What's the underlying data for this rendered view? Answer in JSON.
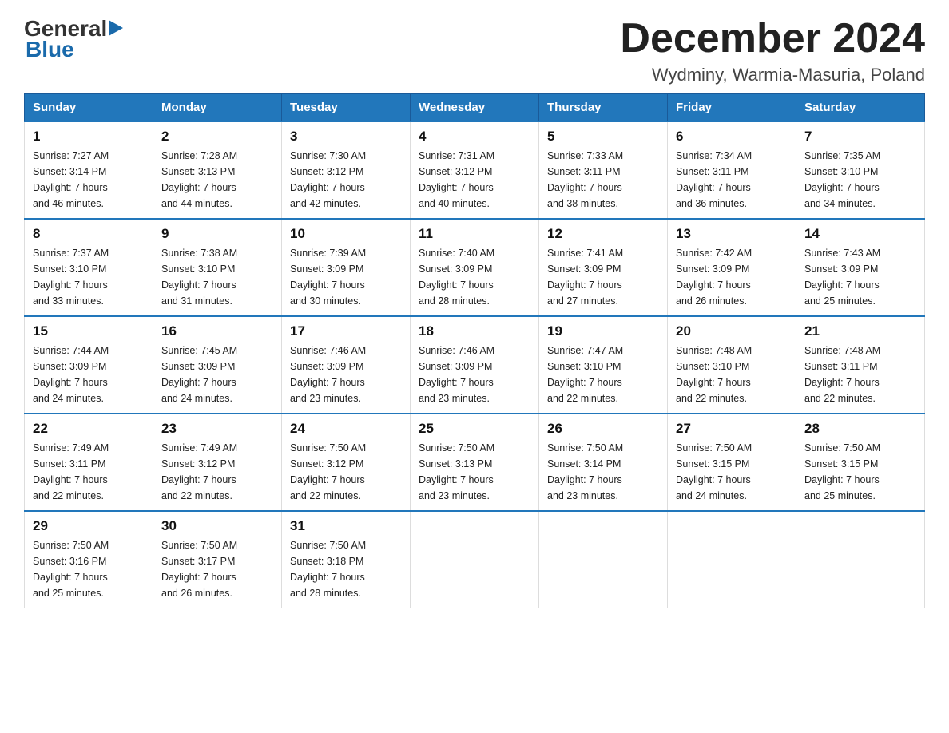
{
  "header": {
    "logo_general": "General",
    "logo_blue": "Blue",
    "title": "December 2024",
    "subtitle": "Wydminy, Warmia-Masuria, Poland"
  },
  "days_of_week": [
    "Sunday",
    "Monday",
    "Tuesday",
    "Wednesday",
    "Thursday",
    "Friday",
    "Saturday"
  ],
  "weeks": [
    [
      {
        "day": "1",
        "sunrise": "7:27 AM",
        "sunset": "3:14 PM",
        "daylight": "7 hours and 46 minutes."
      },
      {
        "day": "2",
        "sunrise": "7:28 AM",
        "sunset": "3:13 PM",
        "daylight": "7 hours and 44 minutes."
      },
      {
        "day": "3",
        "sunrise": "7:30 AM",
        "sunset": "3:12 PM",
        "daylight": "7 hours and 42 minutes."
      },
      {
        "day": "4",
        "sunrise": "7:31 AM",
        "sunset": "3:12 PM",
        "daylight": "7 hours and 40 minutes."
      },
      {
        "day": "5",
        "sunrise": "7:33 AM",
        "sunset": "3:11 PM",
        "daylight": "7 hours and 38 minutes."
      },
      {
        "day": "6",
        "sunrise": "7:34 AM",
        "sunset": "3:11 PM",
        "daylight": "7 hours and 36 minutes."
      },
      {
        "day": "7",
        "sunrise": "7:35 AM",
        "sunset": "3:10 PM",
        "daylight": "7 hours and 34 minutes."
      }
    ],
    [
      {
        "day": "8",
        "sunrise": "7:37 AM",
        "sunset": "3:10 PM",
        "daylight": "7 hours and 33 minutes."
      },
      {
        "day": "9",
        "sunrise": "7:38 AM",
        "sunset": "3:10 PM",
        "daylight": "7 hours and 31 minutes."
      },
      {
        "day": "10",
        "sunrise": "7:39 AM",
        "sunset": "3:09 PM",
        "daylight": "7 hours and 30 minutes."
      },
      {
        "day": "11",
        "sunrise": "7:40 AM",
        "sunset": "3:09 PM",
        "daylight": "7 hours and 28 minutes."
      },
      {
        "day": "12",
        "sunrise": "7:41 AM",
        "sunset": "3:09 PM",
        "daylight": "7 hours and 27 minutes."
      },
      {
        "day": "13",
        "sunrise": "7:42 AM",
        "sunset": "3:09 PM",
        "daylight": "7 hours and 26 minutes."
      },
      {
        "day": "14",
        "sunrise": "7:43 AM",
        "sunset": "3:09 PM",
        "daylight": "7 hours and 25 minutes."
      }
    ],
    [
      {
        "day": "15",
        "sunrise": "7:44 AM",
        "sunset": "3:09 PM",
        "daylight": "7 hours and 24 minutes."
      },
      {
        "day": "16",
        "sunrise": "7:45 AM",
        "sunset": "3:09 PM",
        "daylight": "7 hours and 24 minutes."
      },
      {
        "day": "17",
        "sunrise": "7:46 AM",
        "sunset": "3:09 PM",
        "daylight": "7 hours and 23 minutes."
      },
      {
        "day": "18",
        "sunrise": "7:46 AM",
        "sunset": "3:09 PM",
        "daylight": "7 hours and 23 minutes."
      },
      {
        "day": "19",
        "sunrise": "7:47 AM",
        "sunset": "3:10 PM",
        "daylight": "7 hours and 22 minutes."
      },
      {
        "day": "20",
        "sunrise": "7:48 AM",
        "sunset": "3:10 PM",
        "daylight": "7 hours and 22 minutes."
      },
      {
        "day": "21",
        "sunrise": "7:48 AM",
        "sunset": "3:11 PM",
        "daylight": "7 hours and 22 minutes."
      }
    ],
    [
      {
        "day": "22",
        "sunrise": "7:49 AM",
        "sunset": "3:11 PM",
        "daylight": "7 hours and 22 minutes."
      },
      {
        "day": "23",
        "sunrise": "7:49 AM",
        "sunset": "3:12 PM",
        "daylight": "7 hours and 22 minutes."
      },
      {
        "day": "24",
        "sunrise": "7:50 AM",
        "sunset": "3:12 PM",
        "daylight": "7 hours and 22 minutes."
      },
      {
        "day": "25",
        "sunrise": "7:50 AM",
        "sunset": "3:13 PM",
        "daylight": "7 hours and 23 minutes."
      },
      {
        "day": "26",
        "sunrise": "7:50 AM",
        "sunset": "3:14 PM",
        "daylight": "7 hours and 23 minutes."
      },
      {
        "day": "27",
        "sunrise": "7:50 AM",
        "sunset": "3:15 PM",
        "daylight": "7 hours and 24 minutes."
      },
      {
        "day": "28",
        "sunrise": "7:50 AM",
        "sunset": "3:15 PM",
        "daylight": "7 hours and 25 minutes."
      }
    ],
    [
      {
        "day": "29",
        "sunrise": "7:50 AM",
        "sunset": "3:16 PM",
        "daylight": "7 hours and 25 minutes."
      },
      {
        "day": "30",
        "sunrise": "7:50 AM",
        "sunset": "3:17 PM",
        "daylight": "7 hours and 26 minutes."
      },
      {
        "day": "31",
        "sunrise": "7:50 AM",
        "sunset": "3:18 PM",
        "daylight": "7 hours and 28 minutes."
      },
      null,
      null,
      null,
      null
    ]
  ],
  "labels": {
    "sunrise": "Sunrise:",
    "sunset": "Sunset:",
    "daylight": "Daylight:"
  }
}
